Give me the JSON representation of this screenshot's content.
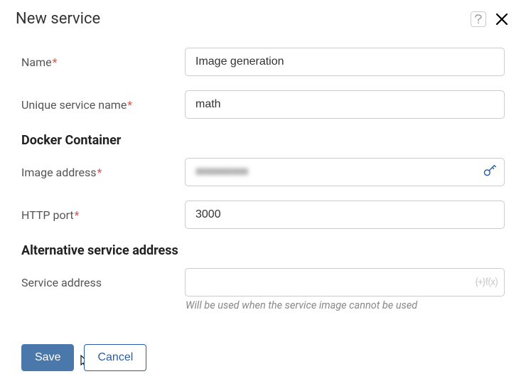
{
  "dialog": {
    "title": "New service"
  },
  "fields": {
    "name": {
      "label": "Name",
      "value": "Image generation"
    },
    "unique": {
      "label": "Unique service name",
      "value": "math"
    },
    "section_docker": "Docker Container",
    "image_address": {
      "label": "Image address",
      "masked": "IIIIIIIIIIIIIIIIIIIIIIIIIIIII"
    },
    "http_port": {
      "label": "HTTP port",
      "value": "3000"
    },
    "section_alt": "Alternative service address",
    "service_address": {
      "label": "Service address",
      "value": "",
      "helper": "Will be used when the service image cannot be used"
    },
    "fx_label": "{+}f(x)"
  },
  "actions": {
    "save": "Save",
    "cancel": "Cancel"
  }
}
